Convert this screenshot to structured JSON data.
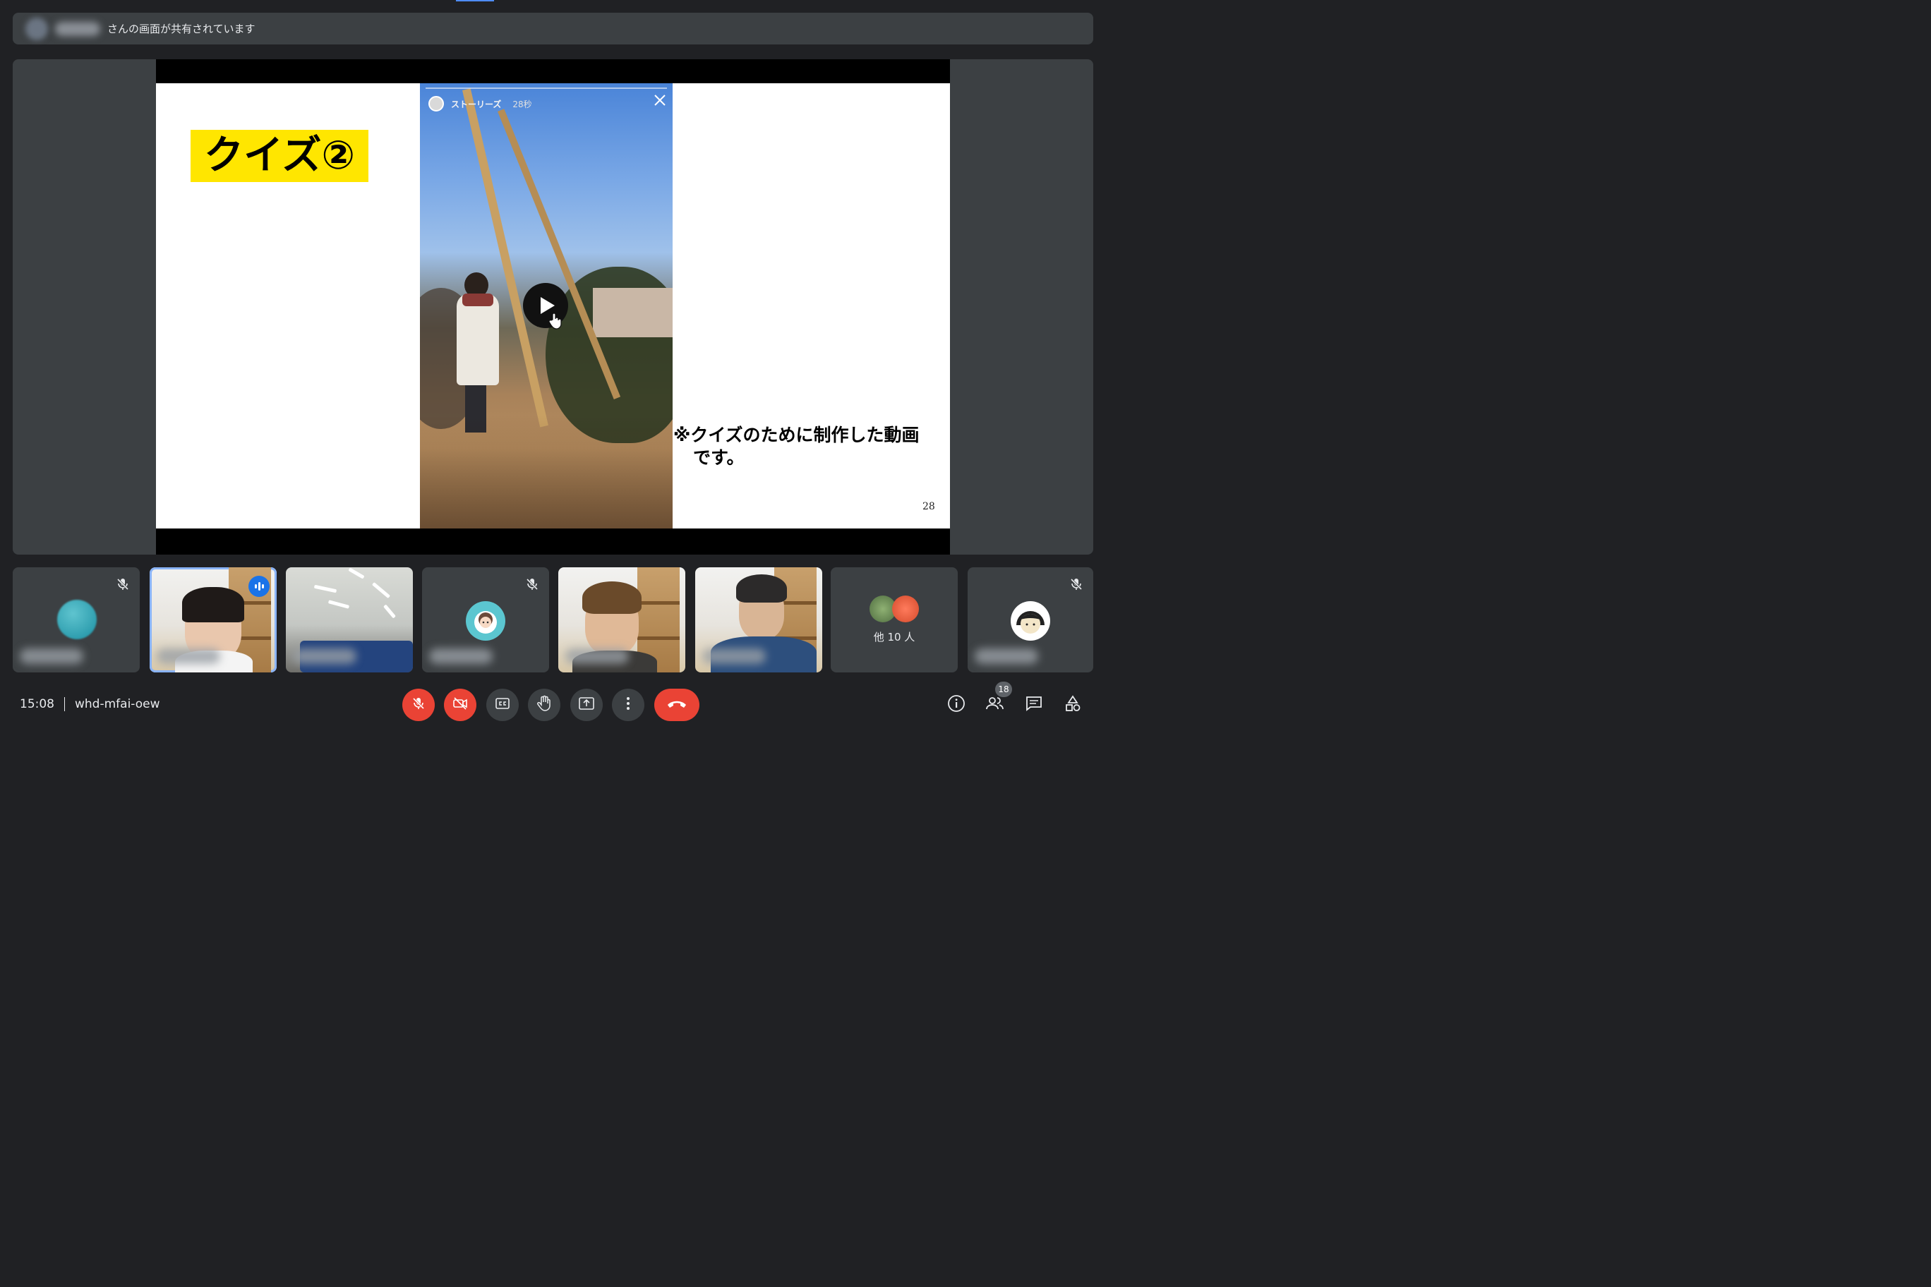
{
  "banner": {
    "text": "さんの画面が共有されています"
  },
  "slide": {
    "title": "クイズ②",
    "caption_line1": "※クイズのために制作した動画",
    "caption_line2": "です。",
    "page_number": "28",
    "video": {
      "label": "ストーリーズ",
      "time": "28秒"
    }
  },
  "tiles": {
    "others_text": "他 10 人"
  },
  "meeting": {
    "time": "15:08",
    "code": "whd-mfai-oew"
  },
  "participants_count": "18",
  "colors": {
    "end_call": "#ea4335",
    "active_speaker": "#8ab4f8",
    "badge_blue": "#1a73e8"
  }
}
